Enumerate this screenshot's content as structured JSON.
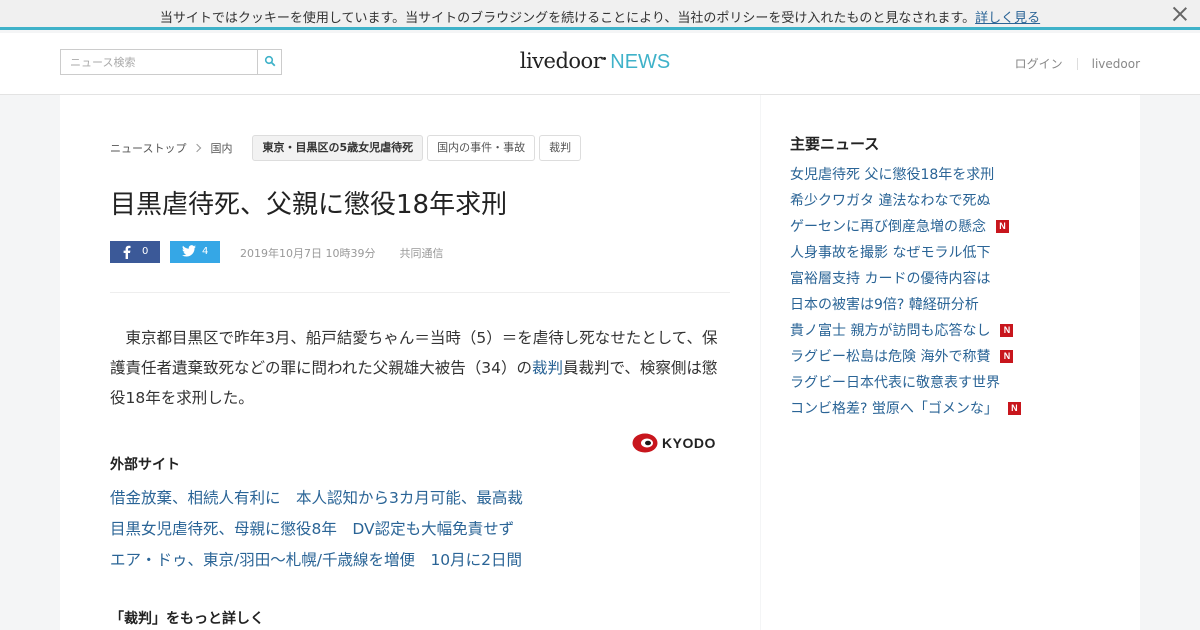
{
  "cookie_bar": {
    "message": "当サイトではクッキーを使用しています。当サイトのブラウジングを続けることにより、当社のポリシーを受け入れたものと見なされます。",
    "link_label": "詳しく見る",
    "close_icon": "close-icon"
  },
  "header": {
    "search_placeholder": "ニュース検索",
    "search_icon": "search-icon",
    "logo_main": "livedoor",
    "logo_news": "NEWS",
    "login_label": "ログイン",
    "livedoor_label": "livedoor"
  },
  "breadcrumb": {
    "top": "ニューストップ",
    "category": "国内",
    "tags": [
      "東京・目黒区の5歳女児虐待死",
      "国内の事件・事故",
      "裁判"
    ]
  },
  "article": {
    "title": "目黒虐待死、父親に懲役18年求刑",
    "fb_count": "0",
    "tw_count": "4",
    "date": "2019年10月7日 10時39分",
    "source": "共同通信",
    "body_before_link": "　東京都目黒区で昨年3月、船戸結愛ちゃん＝当時（5）＝を虐待し死なせたとして、保護責任者遺棄致死などの罪に問われた父親雄大被告（34）の",
    "body_link": "裁判",
    "body_after_link": "員裁判で、検察側は懲役18年を求刑した。",
    "provider_logo": "KYODO",
    "colors": {
      "fb": "#3b5998",
      "tw": "#35a7e6",
      "kyodo_red": "#c8161d"
    }
  },
  "external": {
    "heading": "外部サイト",
    "links": [
      "借金放棄、相続人有利に　本人認知から3カ月可能、最高裁",
      "目黒女児虐待死、母親に懲役8年　DV認定も大幅免責せず",
      "エア・ドゥ、東京/羽田～札幌/千歳線を増便　10月に2日間"
    ]
  },
  "more": {
    "heading": "「裁判」をもっと詳しく"
  },
  "sidebar": {
    "title": "主要ニュース",
    "items": [
      {
        "text": "女児虐待死 父に懲役18年を求刑",
        "badge": ""
      },
      {
        "text": "希少クワガタ 違法なわなで死ぬ",
        "badge": ""
      },
      {
        "text": "ゲーセンに再び倒産急増の懸念",
        "badge": "N"
      },
      {
        "text": "人身事故を撮影 なぜモラル低下",
        "badge": ""
      },
      {
        "text": "富裕層支持 カードの優待内容は",
        "badge": ""
      },
      {
        "text": "日本の被害は9倍? 韓経研分析",
        "badge": ""
      },
      {
        "text": "貴ノ富士 親方が訪問も応答なし",
        "badge": "N"
      },
      {
        "text": "ラグビー松島は危険 海外で称賛",
        "badge": "N"
      },
      {
        "text": "ラグビー日本代表に敬意表す世界",
        "badge": ""
      },
      {
        "text": "コンビ格差? 蛍原へ「ゴメンな」",
        "badge": "N"
      }
    ]
  }
}
